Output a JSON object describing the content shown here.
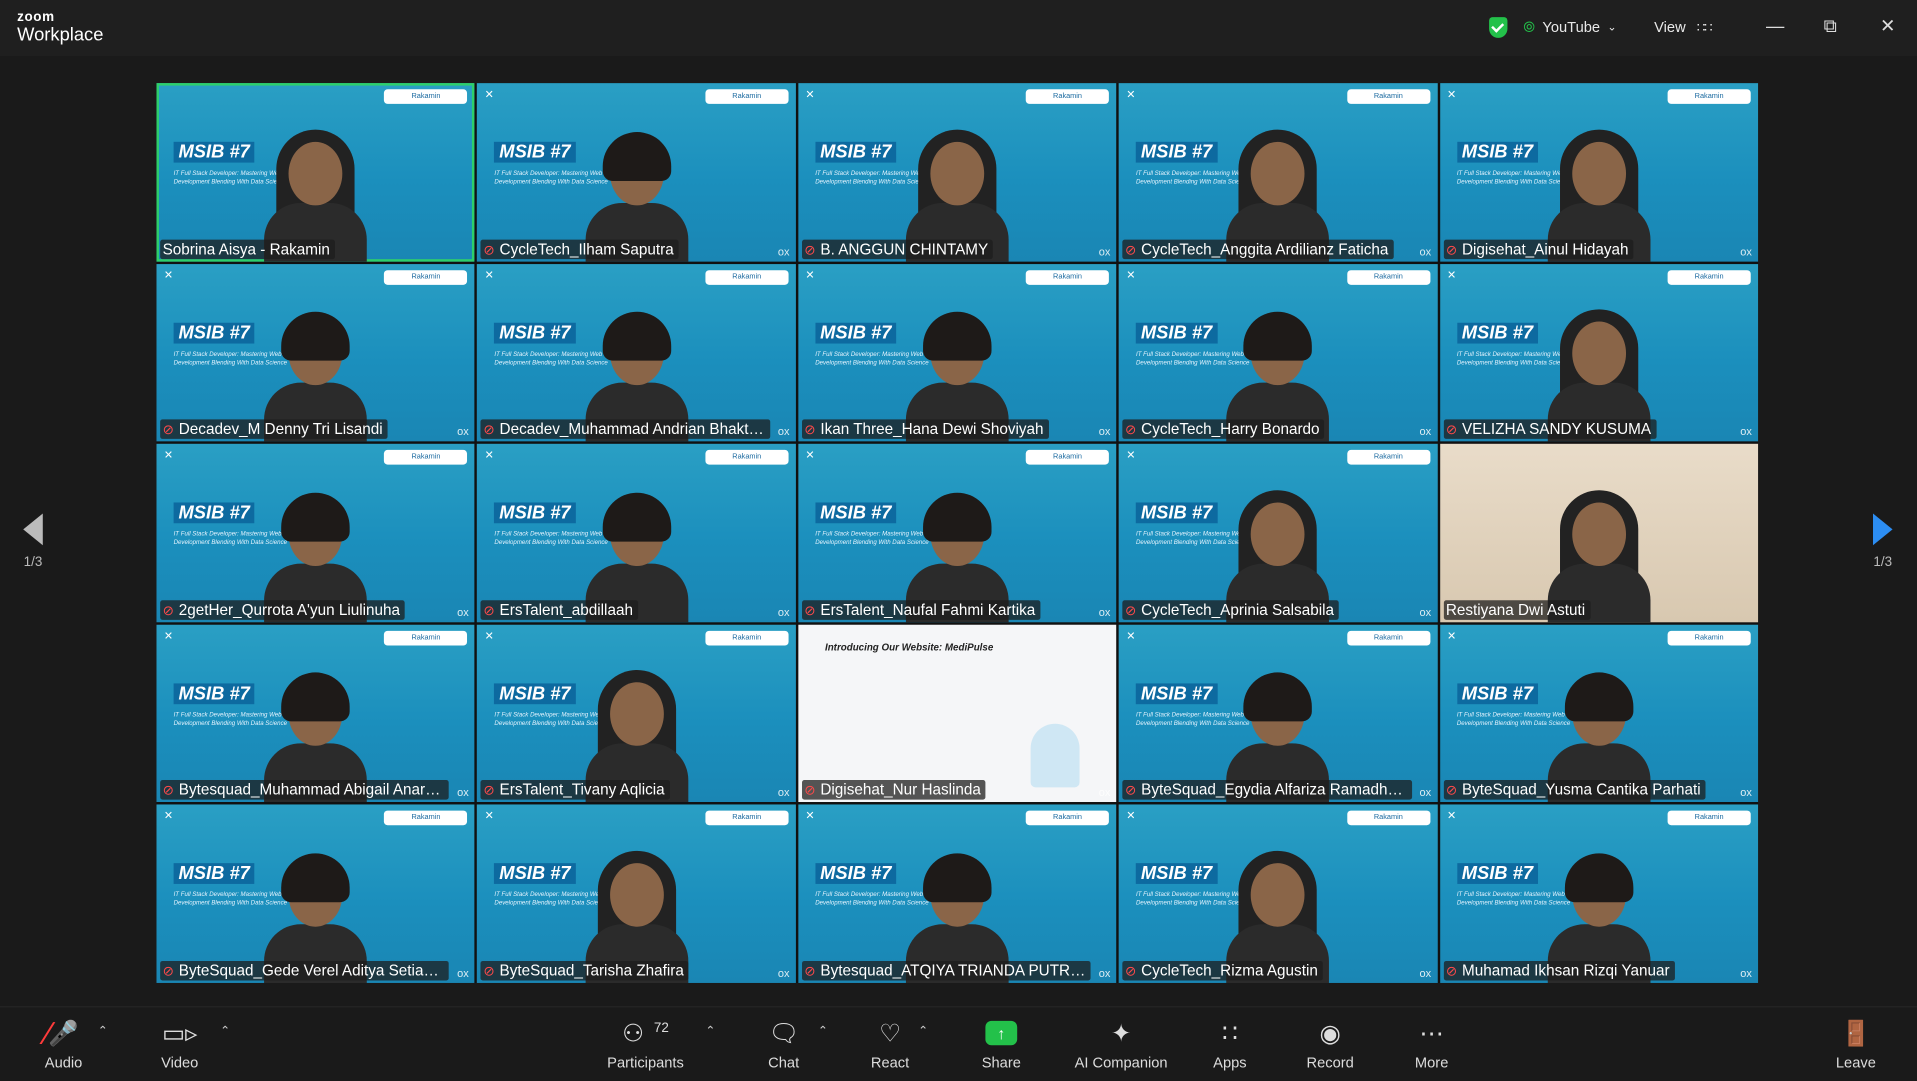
{
  "app": {
    "brand_small": "zoom",
    "brand_large": "Workplace"
  },
  "topbar": {
    "stream_label": "YouTube",
    "view_label": "View"
  },
  "colors": {
    "accent_green": "#2ecf6a",
    "tile_blue": "#1b8fbd",
    "mic_muted": "#ff4a4a",
    "next_arrow": "#2c8df2"
  },
  "tiles": {
    "msib_text": "MSIB #7",
    "subtitle_text": "IT Full Stack Developer: Mastering Web Development Blending With Data Science",
    "brand_badge": "Rakamin",
    "slide_title": "Introducing Our Website: MediPulse",
    "participants": [
      {
        "name": "Sobrina Aisya - Rakamin",
        "muted": false,
        "active": true
      },
      {
        "name": "CycleTech_Ilham Saputra",
        "muted": true
      },
      {
        "name": "B. ANGGUN CHINTAMY",
        "muted": true
      },
      {
        "name": "CycleTech_Anggita Ardilianz Faticha",
        "muted": true
      },
      {
        "name": "Digisehat_Ainul Hidayah",
        "muted": true
      },
      {
        "name": "Decadev_M Denny Tri Lisandi",
        "muted": true
      },
      {
        "name": "Decadev_Muhammad Andrian Bhakti M...",
        "muted": true
      },
      {
        "name": "Ikan Three_Hana Dewi Shoviyah",
        "muted": true
      },
      {
        "name": "CycleTech_Harry Bonardo",
        "muted": true
      },
      {
        "name": "VELIZHA SANDY KUSUMA",
        "muted": true
      },
      {
        "name": "2getHer_Qurrota A'yun Liulinuha",
        "muted": true
      },
      {
        "name": "ErsTalent_abdillaah",
        "muted": true
      },
      {
        "name": "ErsTalent_Naufal Fahmi Kartika",
        "muted": true
      },
      {
        "name": "CycleTech_Aprinia Salsabila",
        "muted": true
      },
      {
        "name": "Restiyana Dwi Astuti",
        "muted": false
      },
      {
        "name": "Bytesquad_Muhammad Abigail Anargya",
        "muted": true
      },
      {
        "name": "ErsTalent_Tivany Aqlicia",
        "muted": true
      },
      {
        "name": "Digisehat_Nur Haslinda",
        "muted": true
      },
      {
        "name": "ByteSquad_Egydia Alfariza Ramadhani",
        "muted": true
      },
      {
        "name": "ByteSquad_Yusma Cantika Parhati",
        "muted": true
      },
      {
        "name": "ByteSquad_Gede Verel Aditya Setiabudi",
        "muted": true
      },
      {
        "name": "ByteSquad_Tarisha Zhafira",
        "muted": true
      },
      {
        "name": "Bytesquad_ATQIYA TRIANDA PUTRA AN...",
        "muted": true
      },
      {
        "name": "CycleTech_Rizma Agustin",
        "muted": true
      },
      {
        "name": "Muhamad Ikhsan Rizqi Yanuar",
        "muted": true
      }
    ]
  },
  "pager": {
    "left": "1/3",
    "right": "1/3"
  },
  "toolbar": {
    "audio": "Audio",
    "video": "Video",
    "participants": "Participants",
    "participants_count": "72",
    "chat": "Chat",
    "react": "React",
    "share": "Share",
    "ai": "AI Companion",
    "apps": "Apps",
    "record": "Record",
    "more": "More",
    "leave": "Leave"
  }
}
